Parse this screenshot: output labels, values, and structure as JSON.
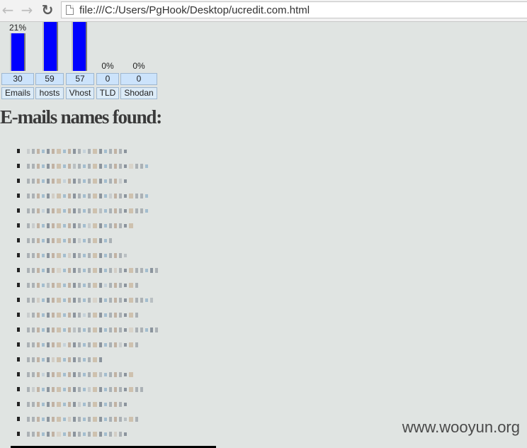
{
  "browser": {
    "back_icon": "arrow-left-icon",
    "forward_icon": "arrow-right-icon",
    "reload_icon": "reload-icon",
    "url": "file:///C:/Users/PgHook/Desktop/ucredit.com.html"
  },
  "stats": [
    {
      "label": "Emails",
      "count": "30",
      "percent_text": "21%",
      "percent": 21
    },
    {
      "label": "hosts",
      "count": "59",
      "percent_text": "",
      "percent": 41
    },
    {
      "label": "Vhost",
      "count": "57",
      "percent_text": "",
      "percent": 40
    },
    {
      "label": "TLD",
      "count": "0",
      "percent_text": "0%",
      "percent": 0
    },
    {
      "label": "Shodan",
      "count": "0",
      "percent_text": "0%",
      "percent": 0
    }
  ],
  "bar_color": "#0000ff",
  "section_title": "E-mails names found:",
  "emails_visible_count": 20,
  "watermark": "www.wooyun.org"
}
